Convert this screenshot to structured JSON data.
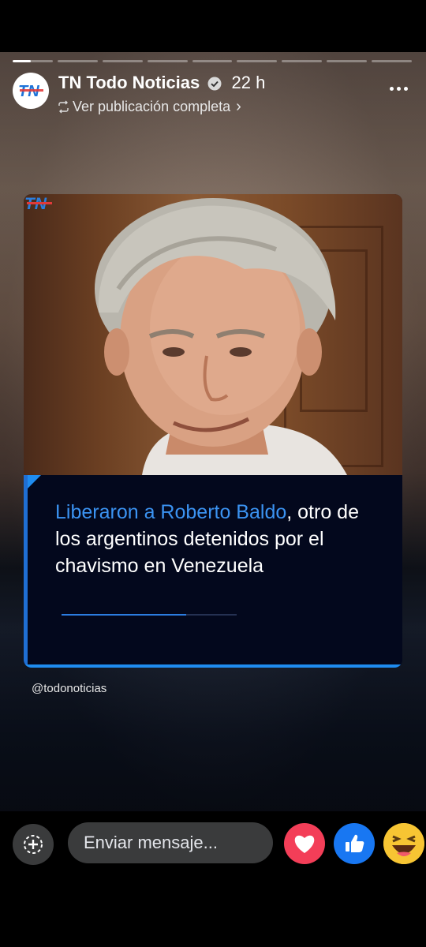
{
  "story": {
    "progress": {
      "segments": 9,
      "current_index": 0,
      "current_fraction": 0.45
    },
    "page_name": "TN Todo Noticias",
    "time_ago": "22 h",
    "view_link": "Ver publicación completa",
    "handle": "@todonoticias",
    "card": {
      "headline_highlight": "Liberaron a Roberto Baldo",
      "headline_rest": ", otro de los argentinos detenidos por el chavismo en Venezuela",
      "logo_text": "TN"
    }
  },
  "footer": {
    "message_placeholder": "Enviar mensaje...",
    "reactions": [
      "love-icon",
      "like-icon",
      "haha-icon"
    ]
  },
  "colors": {
    "accent": "#3b93f2",
    "card_bg": "#03081d",
    "love": "#f33e58",
    "like": "#1877f2",
    "haha": "#f7c533"
  }
}
